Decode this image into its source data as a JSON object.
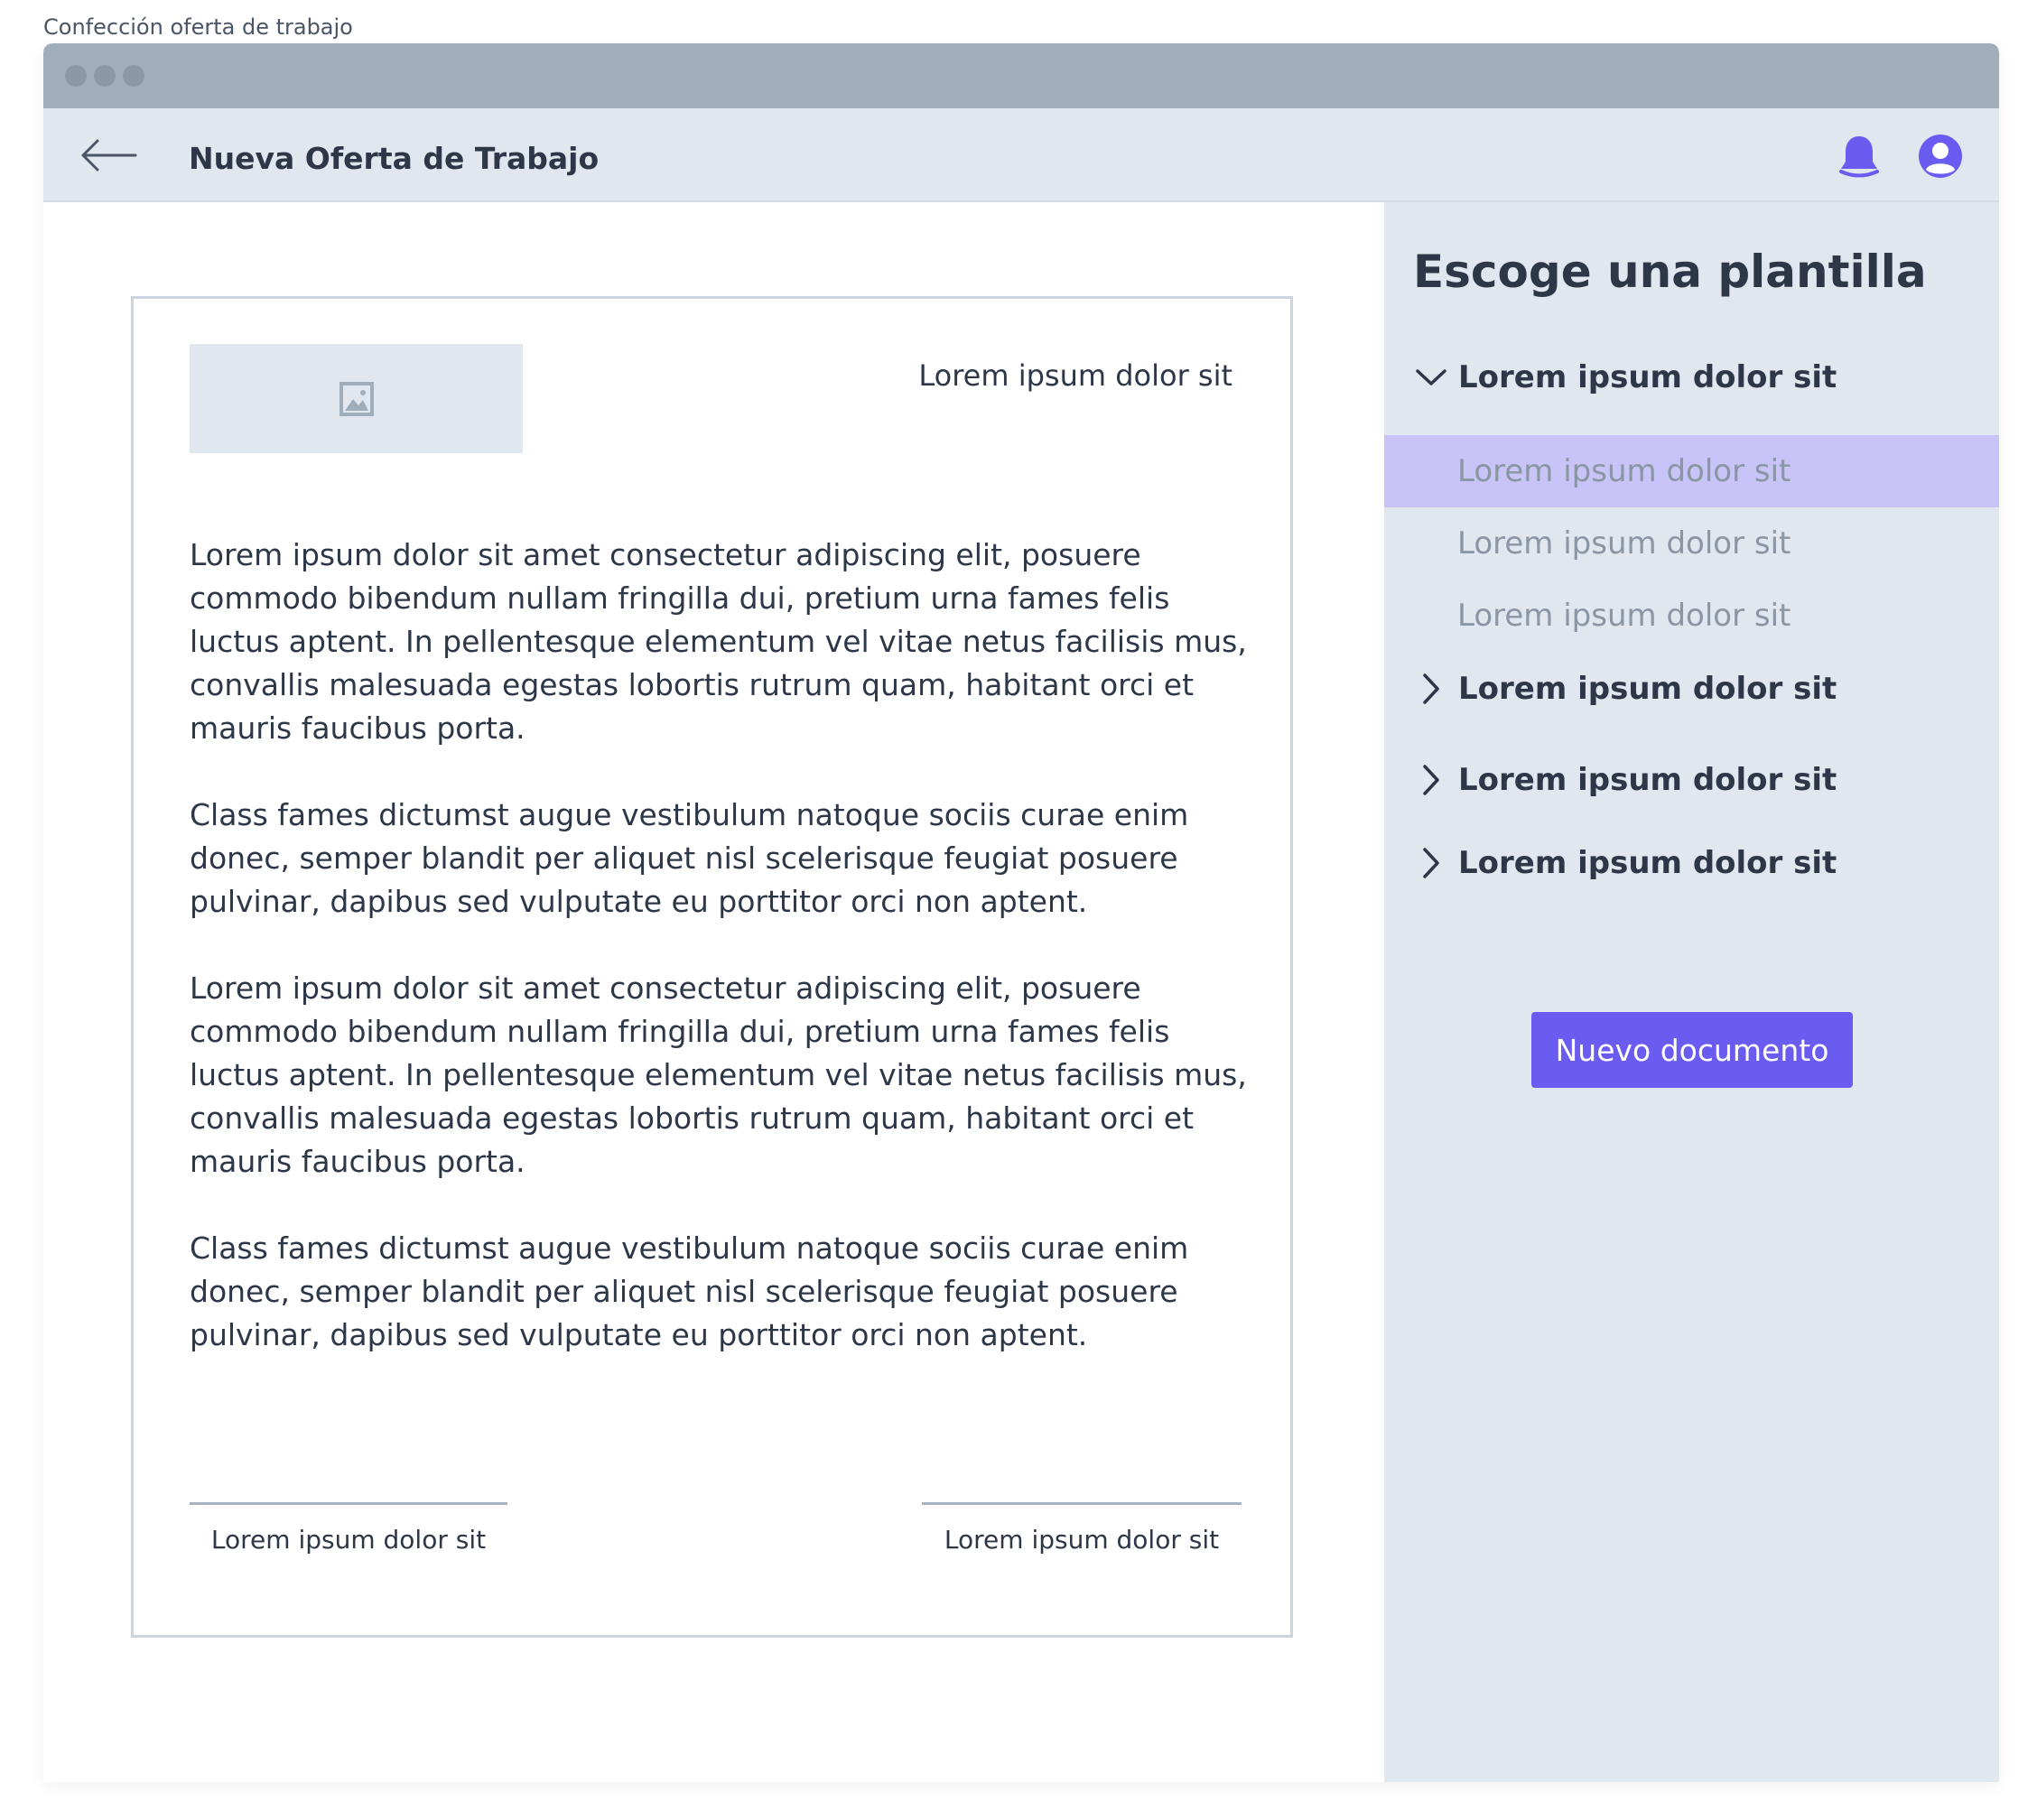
{
  "frame": {
    "title": "Confección oferta de trabajo"
  },
  "appbar": {
    "title": "Nueva Oferta de Trabajo"
  },
  "icons": {
    "back": "arrow-left-icon",
    "notifications": "bell-icon",
    "profile": "user-avatar-icon",
    "image": "image-placeholder-icon"
  },
  "document": {
    "header_text": "Lorem ipsum dolor sit",
    "paragraphs": [
      "Lorem ipsum dolor sit amet consectetur adipiscing elit, posuere commodo bibendum nullam fringilla dui, pretium urna fames felis luctus aptent. In pellentesque elementum vel vitae netus facilisis mus, convallis malesuada egestas lobortis rutrum quam, habitant orci et mauris faucibus porta.",
      "Class fames dictumst augue vestibulum natoque sociis curae enim donec, semper blandit per aliquet nisl scelerisque feugiat posuere pulvinar, dapibus sed vulputate eu porttitor orci non aptent.",
      "Lorem ipsum dolor sit amet consectetur adipiscing elit, posuere commodo bibendum nullam fringilla dui, pretium urna fames felis luctus aptent. In pellentesque elementum vel vitae netus facilisis mus, convallis malesuada egestas lobortis rutrum quam, habitant orci et mauris faucibus porta.",
      "Class fames dictumst augue vestibulum natoque sociis curae enim donec, semper blandit per aliquet nisl scelerisque feugiat posuere pulvinar, dapibus sed vulputate eu porttitor orci non aptent."
    ],
    "signature_left": "Lorem ipsum dolor sit",
    "signature_right": "Lorem ipsum dolor sit"
  },
  "panel": {
    "title": "Escoge una plantilla",
    "groups": [
      {
        "label": "Lorem ipsum dolor sit",
        "expanded": true,
        "items": [
          {
            "label": "Lorem ipsum dolor sit",
            "selected": true
          },
          {
            "label": "Lorem ipsum dolor sit",
            "selected": false
          },
          {
            "label": "Lorem ipsum dolor sit",
            "selected": false
          }
        ]
      },
      {
        "label": "Lorem ipsum dolor sit",
        "expanded": false
      },
      {
        "label": "Lorem ipsum dolor sit",
        "expanded": false
      },
      {
        "label": "Lorem ipsum dolor sit",
        "expanded": false
      }
    ],
    "new_document_label": "Nuevo documento"
  },
  "colors": {
    "accent": "#6a5cf0",
    "selected_bg": "#c8c4f7",
    "panel_bg": "#e1e7ee",
    "titlebar": "#a0aebb"
  }
}
